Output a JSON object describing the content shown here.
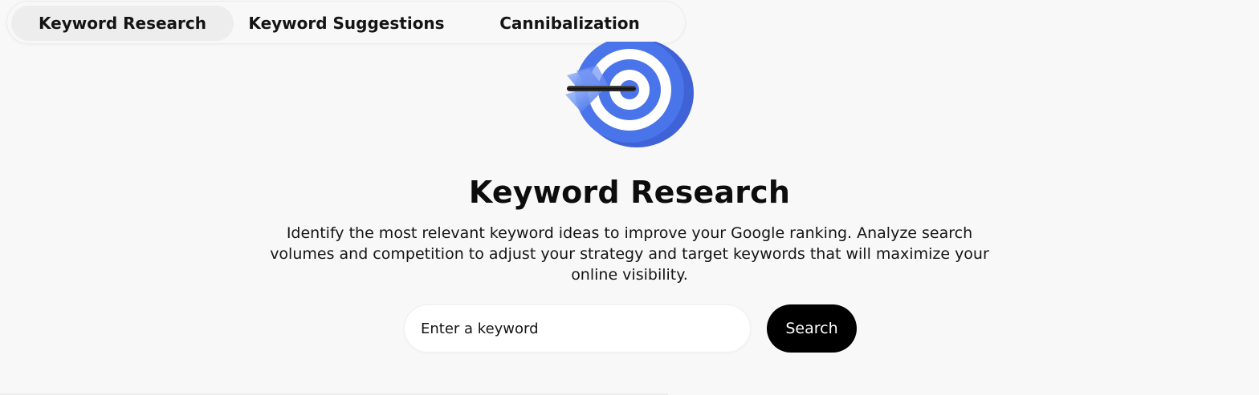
{
  "tabs": [
    {
      "label": "Keyword Research",
      "active": true
    },
    {
      "label": "Keyword Suggestions",
      "active": false
    },
    {
      "label": "Cannibalization",
      "active": false
    }
  ],
  "hero": {
    "icon": "target-arrow-icon",
    "title": "Keyword Research",
    "description": "Identify the most relevant keyword ideas to improve your Google ranking. Analyze search volumes and competition to adjust your strategy and target keywords that will maximize your online visibility."
  },
  "search": {
    "placeholder": "Enter a keyword",
    "value": "",
    "button_label": "Search"
  },
  "colors": {
    "background": "#f8f8f8",
    "target_blue": "#4a74ea",
    "target_white": "#ffffff",
    "button": "#000000"
  }
}
